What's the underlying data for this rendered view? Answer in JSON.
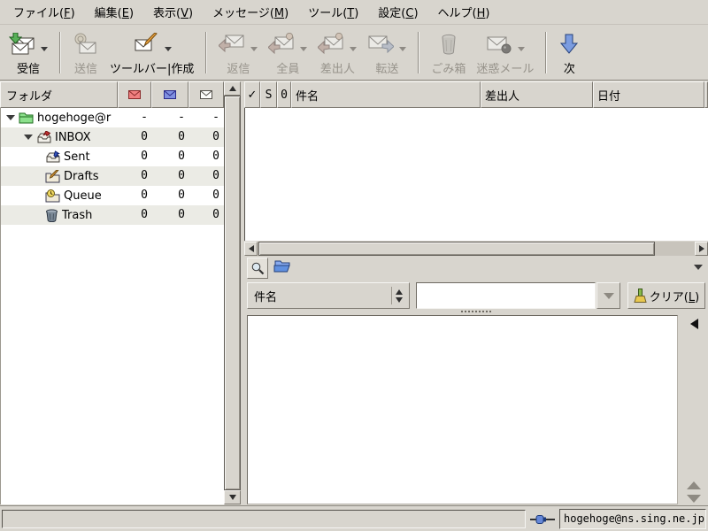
{
  "colors": {
    "window_bg": "#d8d5ce",
    "list_stripe": "#ebebe5",
    "disabled_label": "#97938b",
    "next_arrow_blue": "#7b9ce0",
    "account_folder_green": "#8ce08c",
    "new_envelope_red": "#f08080",
    "unread_envelope_blue": "#8090e0"
  },
  "menu": {
    "items": [
      {
        "pre": "ファイル(",
        "key": "F",
        "post": ")"
      },
      {
        "pre": "編集(",
        "key": "E",
        "post": ")"
      },
      {
        "pre": "表示(",
        "key": "V",
        "post": ")"
      },
      {
        "pre": "メッセージ(",
        "key": "M",
        "post": ")"
      },
      {
        "pre": "ツール(",
        "key": "T",
        "post": ")"
      },
      {
        "pre": "設定(",
        "key": "C",
        "post": ")"
      },
      {
        "pre": "ヘルプ(",
        "key": "H",
        "post": ")"
      }
    ]
  },
  "toolbar": {
    "buttons": [
      {
        "label": "受信",
        "enabled": true,
        "dropdown": true
      },
      {
        "label": "送信",
        "enabled": false,
        "dropdown": false
      },
      {
        "label": "ツールバー|作成",
        "enabled": true,
        "dropdown": true
      },
      {
        "label": "返信",
        "enabled": false,
        "dropdown": true
      },
      {
        "label": "全員",
        "enabled": false,
        "dropdown": true
      },
      {
        "label": "差出人",
        "enabled": false,
        "dropdown": true
      },
      {
        "label": "転送",
        "enabled": false,
        "dropdown": true
      },
      {
        "label": "ごみ箱",
        "enabled": false,
        "dropdown": false
      },
      {
        "label": "迷惑メール",
        "enabled": false,
        "dropdown": true
      },
      {
        "label": "次",
        "enabled": true,
        "dropdown": false
      }
    ]
  },
  "folder_pane": {
    "header": {
      "title": "フォルダ"
    },
    "rows": [
      {
        "name": "hogehoge@r",
        "counts": [
          "-",
          "-",
          "-"
        ]
      },
      {
        "name": "INBOX",
        "counts": [
          "0",
          "0",
          "0"
        ]
      },
      {
        "name": "Sent",
        "counts": [
          "0",
          "0",
          "0"
        ]
      },
      {
        "name": "Drafts",
        "counts": [
          "0",
          "0",
          "0"
        ]
      },
      {
        "name": "Queue",
        "counts": [
          "0",
          "0",
          "0"
        ]
      },
      {
        "name": "Trash",
        "counts": [
          "0",
          "0",
          "0"
        ]
      }
    ]
  },
  "message_list": {
    "columns": {
      "check": "✓",
      "status": "S",
      "clip": "0",
      "subject": "件名",
      "from": "差出人",
      "date": "日付"
    }
  },
  "quick_search": {
    "filter_value": "件名",
    "entry_value": "",
    "clear": {
      "pre": "クリア(",
      "key": "L",
      "post": ")"
    }
  },
  "status_bar": {
    "account": "hogehoge@ns.sing.ne.jp"
  }
}
